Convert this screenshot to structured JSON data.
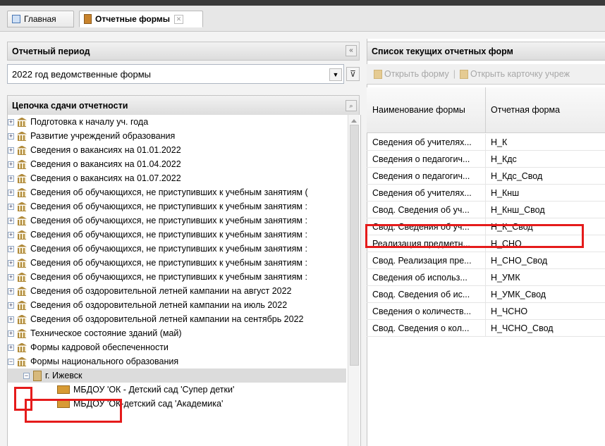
{
  "tabs": {
    "home": "Главная",
    "reports": "Отчетные формы",
    "close": "✕"
  },
  "period": {
    "header": "Отчетный период",
    "collapse": "«",
    "selected": "2022 год ведомственные формы"
  },
  "chain": {
    "header": "Цепочка сдачи отчетности",
    "items": [
      "Подготовка к началу уч. года",
      "Развитие учреждений образования",
      "Сведения о вакансиях на 01.01.2022",
      "Сведения о вакансиях на 01.04.2022",
      "Сведения о вакансиях на 01.07.2022",
      "Сведения об обучающихся, не приступивших к учебным занятиям (",
      "Сведения об обучающихся, не приступивших к учебным занятиям :",
      "Сведения об обучающихся, не приступивших к учебным занятиям :",
      "Сведения об обучающихся, не приступивших к учебным занятиям :",
      "Сведения об обучающихся, не приступивших к учебным занятиям :",
      "Сведения об обучающихся, не приступивших к учебным занятиям :",
      "Сведения об обучающихся, не приступивших к учебным занятиям :",
      "Сведения об оздоровительной летней кампании на август 2022",
      "Сведения об оздоровительной летней кампании на июль 2022",
      "Сведения об оздоровительной летней кампании на сентябрь 2022",
      "Техническое состояние зданий (май)",
      "Формы кадровой обеспеченности",
      "Формы национального образования"
    ],
    "city": "г. Ижевск",
    "orgs": [
      "МБДОУ 'ОК - Детский сад 'Супер детки'",
      "МБДОУ 'ОК-детский сад 'Академика'"
    ]
  },
  "forms": {
    "header": "Список текущих отчетных форм",
    "toolbar": {
      "open_form": "Открыть форму",
      "sep": "|",
      "open_card": "Открыть карточку учреж"
    },
    "columns": [
      "Наименование формы",
      "Отчетная форма"
    ],
    "rows": [
      [
        "Сведения об учителях...",
        "Н_К"
      ],
      [
        "Сведения о педагогич...",
        "Н_Кдс"
      ],
      [
        "Сведения о педагогич...",
        "Н_Кдс_Свод"
      ],
      [
        "Сведения об учителях...",
        "Н_Кнш"
      ],
      [
        "Свод. Сведения об уч...",
        "Н_Кнш_Свод"
      ],
      [
        "Свод. Сведения об уч...",
        "Н_К_Свод"
      ],
      [
        "Реализация предметн...",
        "Н_СНО"
      ],
      [
        "Свод. Реализация пре...",
        "Н_СНО_Свод"
      ],
      [
        "Сведения об использ...",
        "Н_УМК"
      ],
      [
        "Свод. Сведения об ис...",
        "Н_УМК_Свод"
      ],
      [
        "Сведения о количеств...",
        "Н_ЧСНО"
      ],
      [
        "Свод. Сведения о кол...",
        "Н_ЧСНО_Свод"
      ]
    ]
  }
}
